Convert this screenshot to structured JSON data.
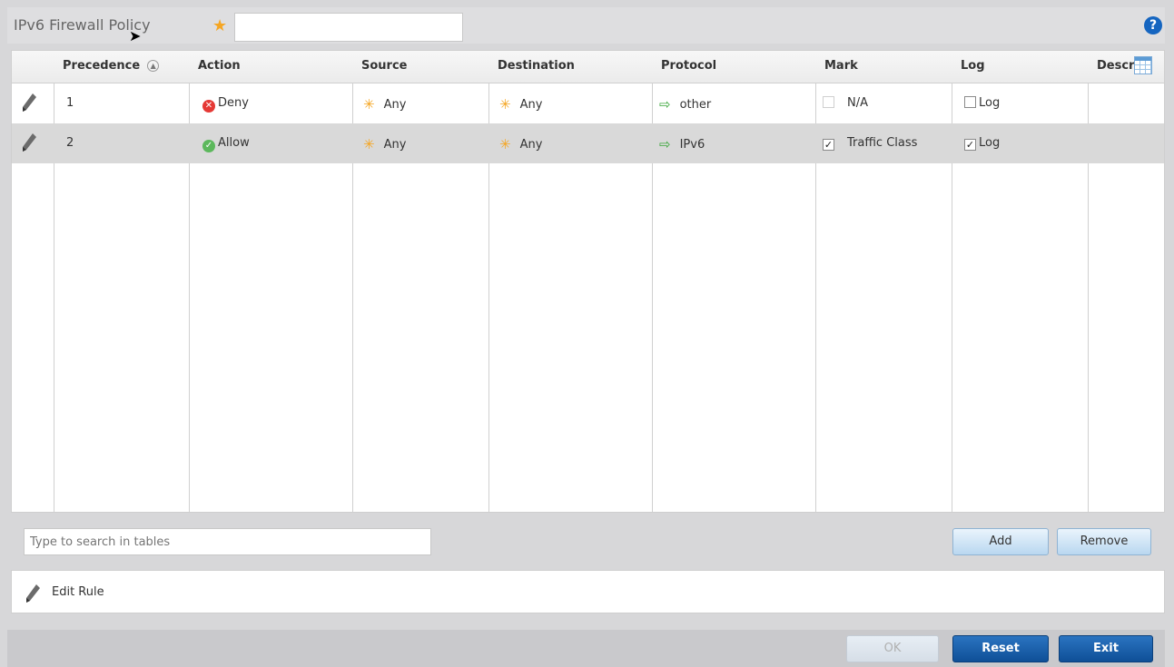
{
  "header": {
    "title": "IPv6 Firewall Policy",
    "name_value": ""
  },
  "columns": [
    "Precedence",
    "Action",
    "Source",
    "Destination",
    "Protocol",
    "Mark",
    "Log",
    "Descr"
  ],
  "rows": [
    {
      "precedence": "1",
      "action": "Deny",
      "source": "Any",
      "destination": "Any",
      "protocol": "other",
      "mark": "N/A",
      "mark_checked": false,
      "log": "Log",
      "log_checked": false
    },
    {
      "precedence": "2",
      "action": "Allow",
      "source": "Any",
      "destination": "Any",
      "protocol": "IPv6",
      "mark": "Traffic Class",
      "mark_checked": true,
      "log": "Log",
      "log_checked": true
    }
  ],
  "search": {
    "placeholder": "Type to search in tables"
  },
  "buttons": {
    "add": "Add",
    "remove": "Remove",
    "ok": "OK",
    "reset": "Reset",
    "exit": "Exit"
  },
  "edit_rule": {
    "label": "Edit Rule"
  },
  "icons": {
    "help": "help-icon",
    "any": "asterisk-icon",
    "protocol": "arrow-right-icon"
  },
  "colors": {
    "accent": "#1565c0",
    "deny": "#e53935",
    "allow": "#5cb85c",
    "required": "#f5a623"
  }
}
